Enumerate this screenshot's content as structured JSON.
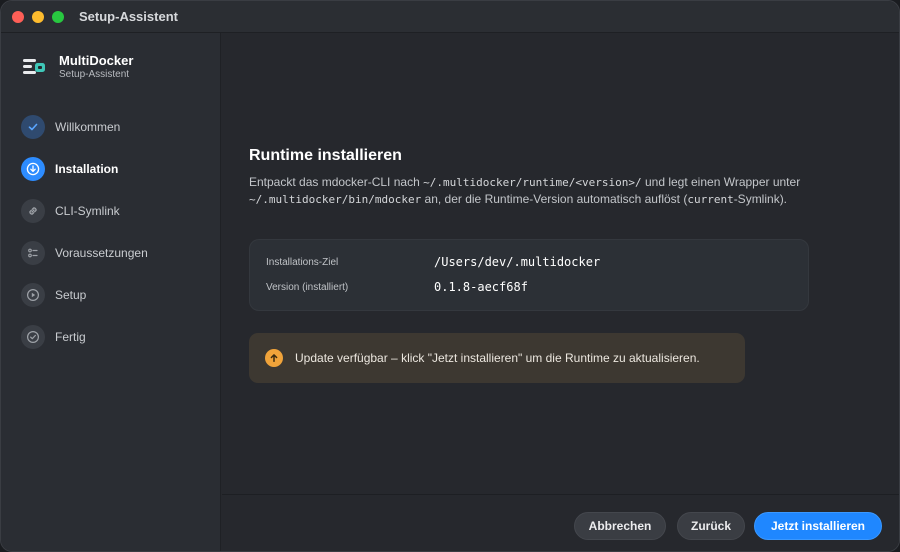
{
  "window": {
    "title": "Setup-Assistent"
  },
  "brand": {
    "name": "MultiDocker",
    "subtitle": "Setup-Assistent"
  },
  "sidebar": {
    "steps": [
      {
        "label": "Willkommen",
        "state": "done",
        "icon": "check-icon"
      },
      {
        "label": "Installation",
        "state": "active",
        "icon": "download-icon"
      },
      {
        "label": "CLI-Symlink",
        "state": "pending",
        "icon": "link-icon"
      },
      {
        "label": "Voraussetzungen",
        "state": "pending",
        "icon": "checklist-icon"
      },
      {
        "label": "Setup",
        "state": "pending",
        "icon": "play-icon"
      },
      {
        "label": "Fertig",
        "state": "pending",
        "icon": "check-badge-icon"
      }
    ]
  },
  "main": {
    "heading": "Runtime installieren",
    "description": {
      "p1": "Entpackt das mdocker-CLI nach ",
      "path1": "~/.multidocker/runtime/<version>/",
      "p2": " und legt einen Wrapper unter ",
      "path2": "~/.multidocker/bin/mdocker",
      "p3": " an, der die Runtime-Version automatisch auflöst (",
      "path3": "current",
      "p4": "-Symlink)."
    },
    "info": [
      {
        "key": "Installations-Ziel",
        "value": "/Users/dev/.multidocker"
      },
      {
        "key": "Version (installiert)",
        "value": "0.1.8-aecf68f"
      }
    ],
    "banner": {
      "text": "Update verfügbar – klick \"Jetzt installieren\" um die Runtime zu aktualisieren.",
      "icon": "arrow-up-icon"
    }
  },
  "footer": {
    "cancel_label": "Abbrechen",
    "back_label": "Zurück",
    "primary_label": "Jetzt installieren"
  },
  "colors": {
    "accent": "#1f87ff",
    "warning": "#f0a33a",
    "brand_teal": "#3fc7b8"
  }
}
